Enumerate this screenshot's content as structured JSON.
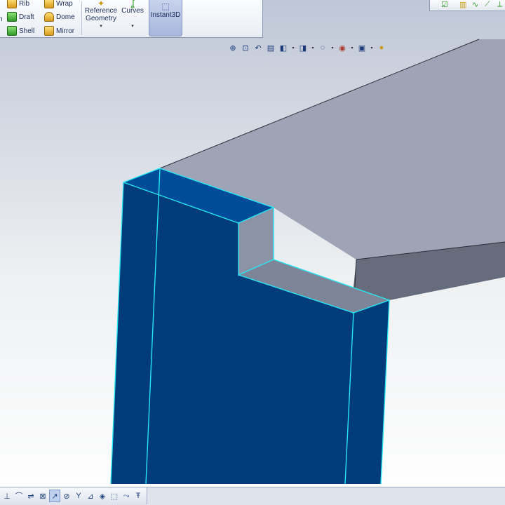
{
  "ribbon": {
    "features": [
      {
        "label": "Rib",
        "icon": "rib-icon"
      },
      {
        "label": "Draft",
        "icon": "draft-icon"
      },
      {
        "label": "Shell",
        "icon": "shell-icon"
      },
      {
        "label": "Wrap",
        "icon": "wrap-icon"
      },
      {
        "label": "Dome",
        "icon": "dome-icon"
      },
      {
        "label": "Mirror",
        "icon": "mirror-icon"
      }
    ],
    "partial_label": "n",
    "reference_geometry": "Reference\nGeometry",
    "curves": "Curves",
    "instant3d": "Instant3D",
    "dropdown_glyph": "▾"
  },
  "heads_up_toolbar": [
    {
      "icon": "zoom-to-fit-icon",
      "glyph": "⊕"
    },
    {
      "icon": "zoom-to-area-icon",
      "glyph": "⊡"
    },
    {
      "icon": "previous-view-icon",
      "glyph": "↶"
    },
    {
      "icon": "section-view-icon",
      "glyph": "▤"
    },
    {
      "icon": "view-orientation-icon",
      "glyph": "◧",
      "dropdown": true
    },
    {
      "icon": "display-style-icon",
      "glyph": "◨",
      "dropdown": true
    },
    {
      "icon": "hide-show-items-icon",
      "glyph": "◌",
      "dropdown": true
    },
    {
      "icon": "edit-appearance-icon",
      "glyph": "◉",
      "dropdown": true
    },
    {
      "icon": "apply-scene-icon",
      "glyph": "▣",
      "dropdown": true
    },
    {
      "icon": "view-settings-icon",
      "glyph": "●"
    }
  ],
  "bottom_toolbar": [
    {
      "icon": "sketch-relation-icon",
      "glyph": "⊥"
    },
    {
      "icon": "offset-icon",
      "glyph": "⌒"
    },
    {
      "icon": "mirror-entities-icon",
      "glyph": "⇌"
    },
    {
      "icon": "selection-filter-icon",
      "glyph": "⊠"
    },
    {
      "icon": "filter-edges-icon",
      "glyph": "↗",
      "active": true
    },
    {
      "icon": "filter-faces-icon",
      "glyph": "⊘"
    },
    {
      "icon": "filter-vertices-icon",
      "glyph": "Y"
    },
    {
      "icon": "filter-planes-icon",
      "glyph": "⊿"
    },
    {
      "icon": "filter-axes-icon",
      "glyph": "◈"
    },
    {
      "icon": "filter-points-icon",
      "glyph": "⬚"
    },
    {
      "icon": "filter-dimensions-icon",
      "glyph": "⤳"
    },
    {
      "icon": "filter-surface-icon",
      "glyph": "Ŧ"
    }
  ],
  "colors": {
    "selected_face": "#003b7a",
    "selected_top_face": "#004c98",
    "edge_highlight": "#27e6f2",
    "part_top": "#9ea3b6",
    "part_front": "#666c7c",
    "notch_face": "#8d93a6"
  }
}
